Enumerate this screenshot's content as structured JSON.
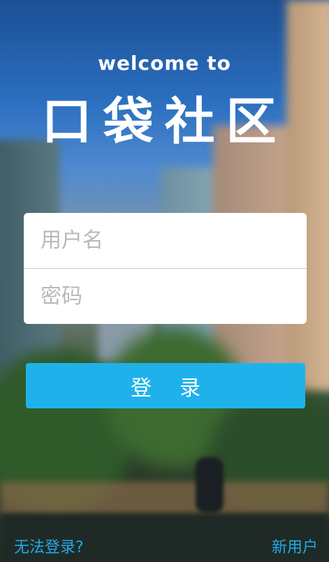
{
  "header": {
    "welcome": "welcome to",
    "title": "口袋社区"
  },
  "form": {
    "username_placeholder": "用户名",
    "password_placeholder": "密码",
    "login_label": "登录"
  },
  "footer": {
    "cant_login": "无法登录?",
    "new_user": "新用户"
  },
  "colors": {
    "accent": "#1fb2ea",
    "link": "#22a9e6"
  }
}
